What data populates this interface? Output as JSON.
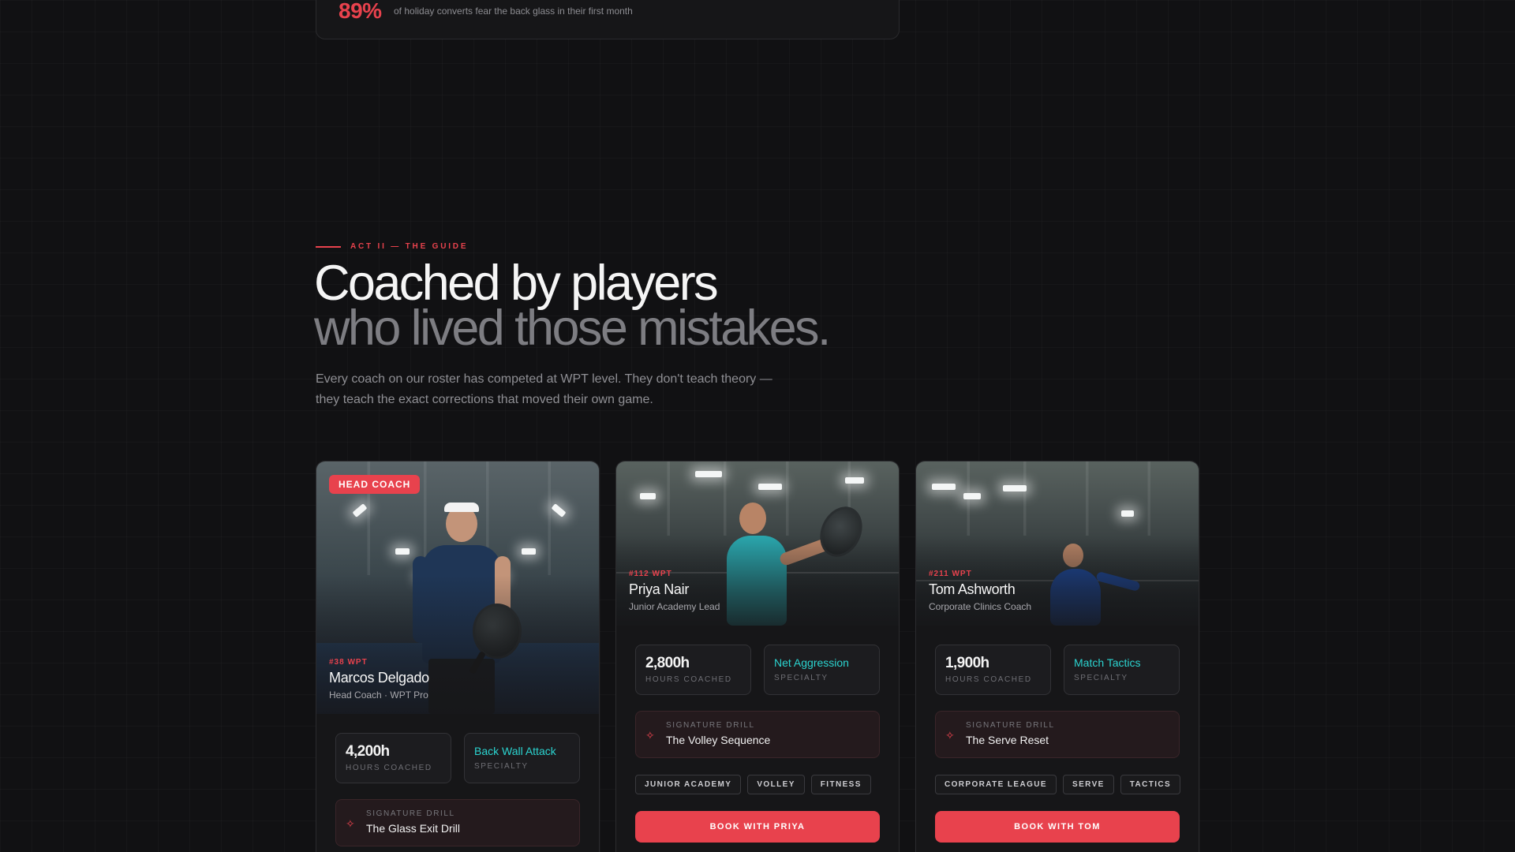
{
  "stat_banner": {
    "value": "89%",
    "description": "of holiday converts fear the back glass in their first month"
  },
  "section": {
    "eyebrow": "ACT II — THE GUIDE",
    "headline_line1": "Coached by players",
    "headline_line2": "who lived those mistakes.",
    "lede": "Every coach on our roster has competed at WPT level. They don't teach theory — they teach the exact corrections that moved their own game."
  },
  "coaches": [
    {
      "badge": "HEAD COACH",
      "rank": "#38 WPT",
      "name": "Marcos Delgado",
      "role": "Head Coach · WPT Pro",
      "hours_value": "4,200h",
      "hours_label": "HOURS COACHED",
      "specialty_value": "Back Wall Attack",
      "specialty_label": "SPECIALTY",
      "drill_label": "SIGNATURE DRILL",
      "drill_value": "The Glass Exit Drill"
    },
    {
      "rank": "#112 WPT",
      "name": "Priya Nair",
      "role": "Junior Academy Lead",
      "hours_value": "2,800h",
      "hours_label": "HOURS COACHED",
      "specialty_value": "Net Aggression",
      "specialty_label": "SPECIALTY",
      "drill_label": "SIGNATURE DRILL",
      "drill_value": "The Volley Sequence",
      "tags": [
        "JUNIOR ACADEMY",
        "VOLLEY",
        "FITNESS"
      ],
      "cta": "BOOK WITH PRIYA"
    },
    {
      "rank": "#211 WPT",
      "name": "Tom Ashworth",
      "role": "Corporate Clinics Coach",
      "hours_value": "1,900h",
      "hours_label": "HOURS COACHED",
      "specialty_value": "Match Tactics",
      "specialty_label": "SPECIALTY",
      "drill_label": "SIGNATURE DRILL",
      "drill_value": "The Serve Reset",
      "tags": [
        "CORPORATE LEAGUE",
        "SERVE",
        "TACTICS"
      ],
      "cta": "BOOK WITH TOM"
    }
  ],
  "colors": {
    "accent": "#e8424d",
    "specialty": "#2bd4d0",
    "background": "#111113"
  },
  "icons": {
    "drill": "sparkle-icon"
  }
}
